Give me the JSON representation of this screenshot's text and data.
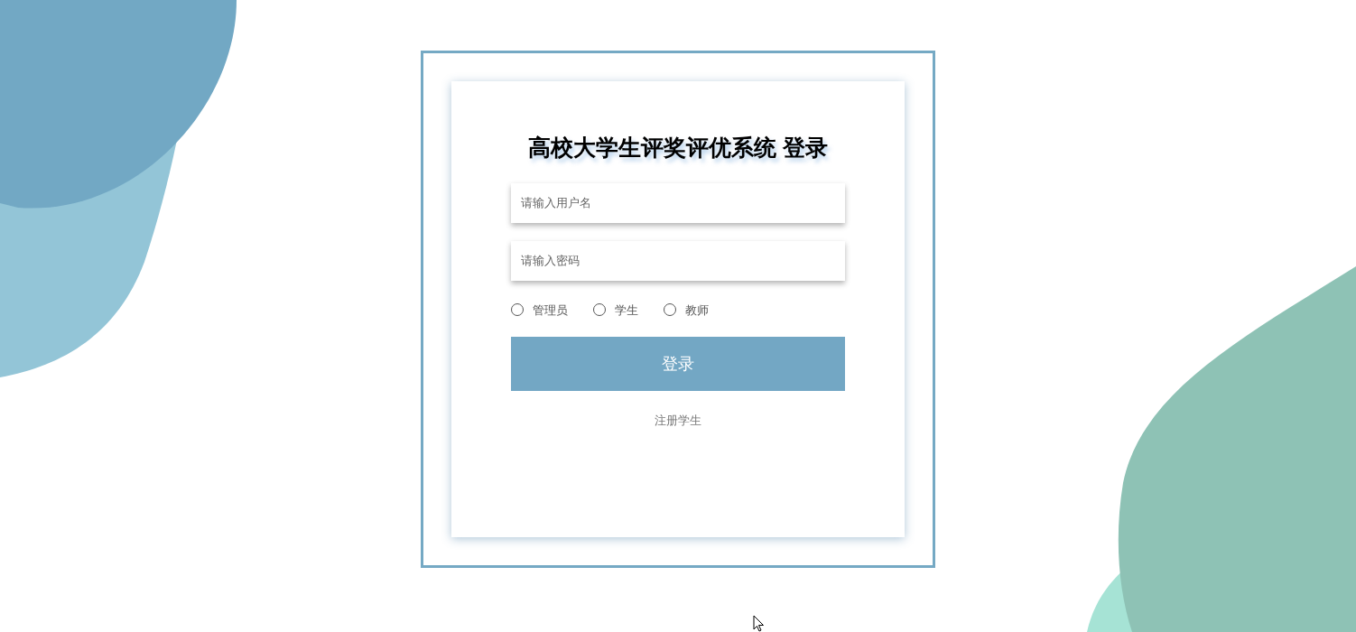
{
  "title": "高校大学生评奖评优系统 登录",
  "username": {
    "placeholder": "请输入用户名"
  },
  "password": {
    "placeholder": "请输入密码"
  },
  "roles": [
    {
      "label": "管理员",
      "selected": false
    },
    {
      "label": "学生",
      "selected": false
    },
    {
      "label": "教师",
      "selected": false
    }
  ],
  "login_button": "登录",
  "register_link": "注册学生"
}
